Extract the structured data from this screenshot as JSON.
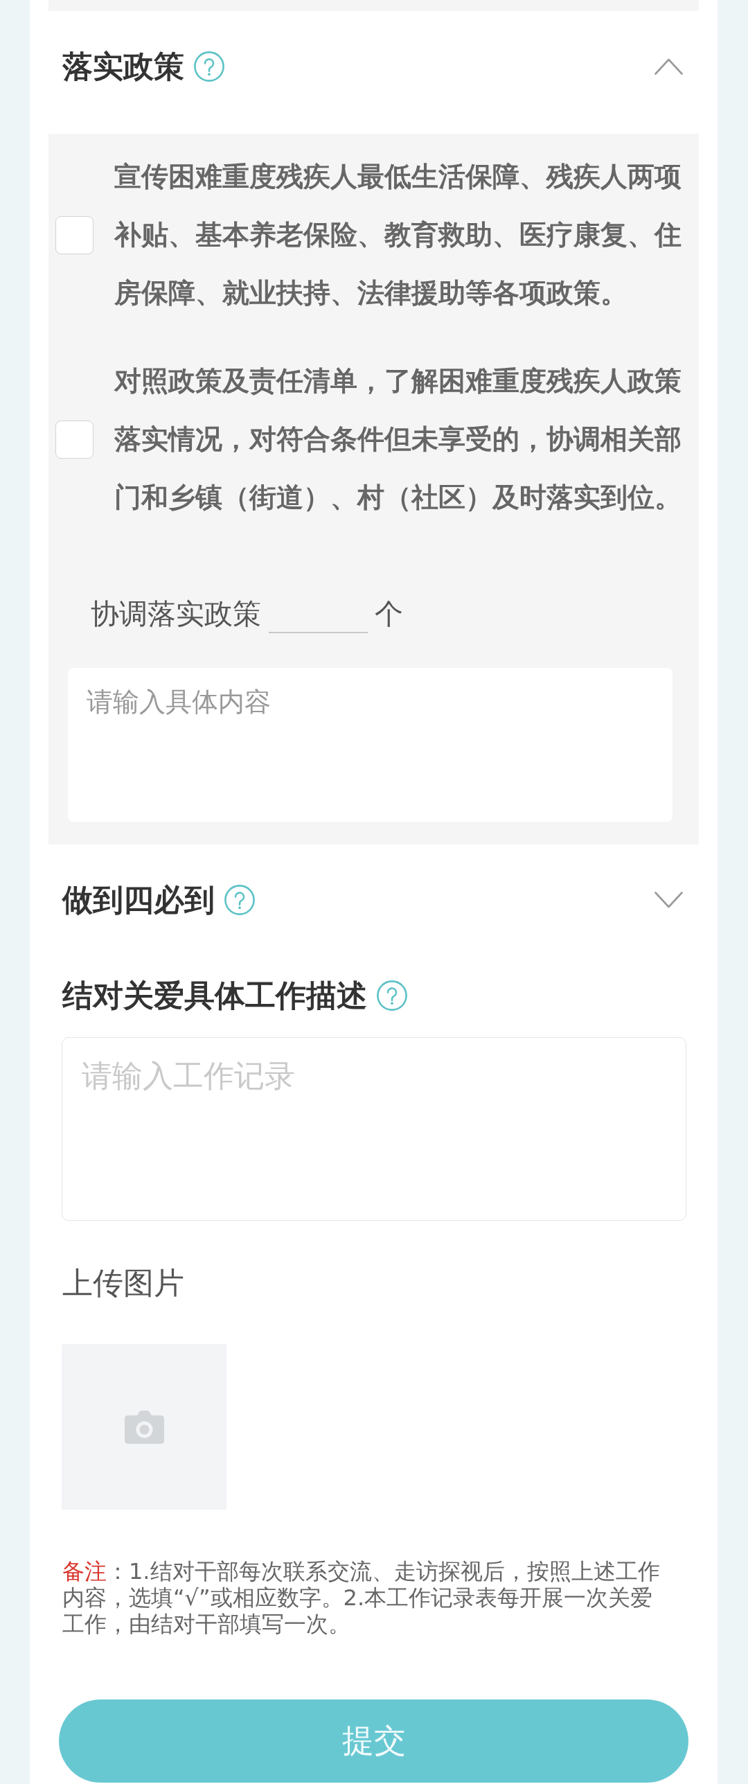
{
  "sections": [
    {
      "title": "落实政策",
      "expanded": true,
      "items": [
        {
          "text": "宣传困难重度残疾人最低生活保障、残疾人两项补贴、基本养老保险、教育救助、医疗康复、住房保障、就业扶持、法律援助等各项政策。",
          "checked": false
        },
        {
          "text": "对照政策及责任清单，了解困难重度残疾人政策落实情况，对符合条件但未享受的，协调相关部门和乡镇（街道）、村（社区）及时落实到位。",
          "checked": false
        }
      ],
      "count_field": {
        "label": "协调落实政策",
        "unit": "个"
      },
      "detail_field": {
        "placeholder": "请输入具体内容"
      }
    },
    {
      "title": "做到四必到",
      "expanded": false
    }
  ],
  "description": {
    "title": "结对关爱具体工作描述",
    "placeholder": "请输入工作记录"
  },
  "upload": {
    "label": "上传图片"
  },
  "note": {
    "label": "备注",
    "text": "：1.结对干部每次联系交流、走访探视后，按照上述工作内容，选填“√”或相应数字。2.本工作记录表每开展一次关爱工作，由结对干部填写一次。"
  },
  "submit": {
    "label": "提交"
  }
}
